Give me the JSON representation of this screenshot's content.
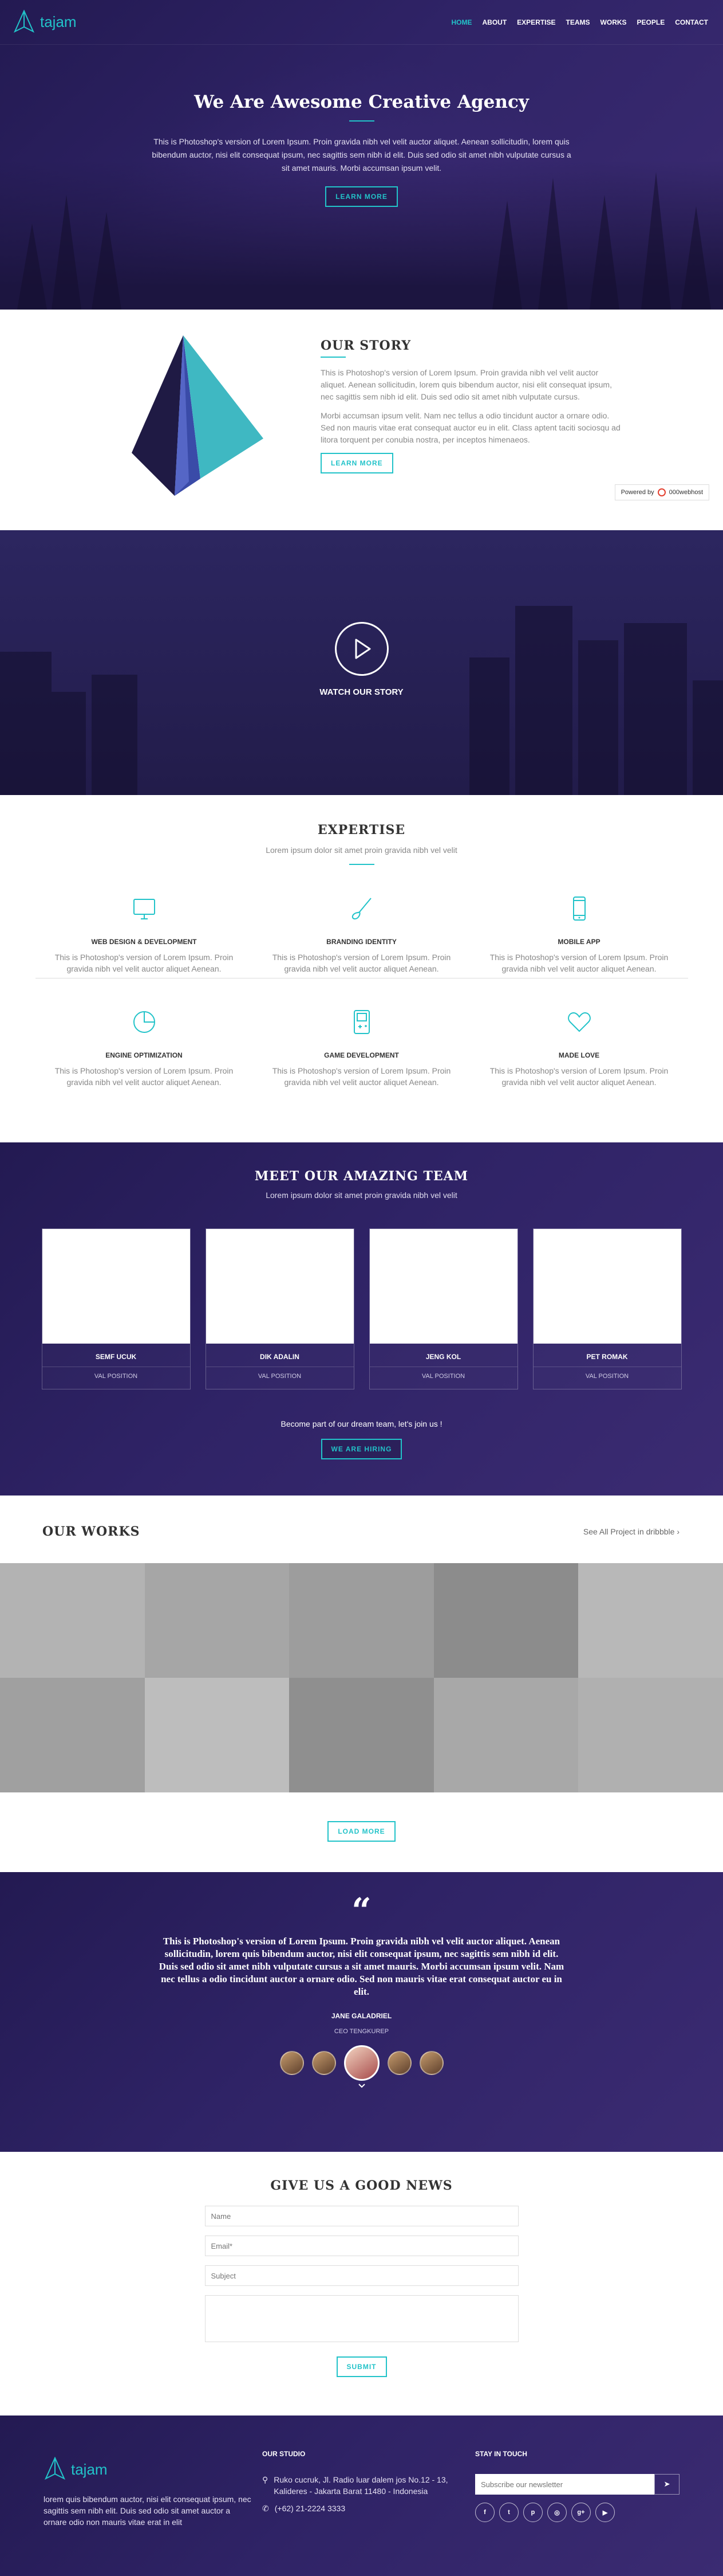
{
  "brand": {
    "name": "tajam",
    "accent": "#22c3c9",
    "dark_purple": "#2a2060"
  },
  "nav": {
    "items": [
      {
        "label": "HOME",
        "active": true
      },
      {
        "label": "ABOUT"
      },
      {
        "label": "EXPERTISE"
      },
      {
        "label": "TEAMS"
      },
      {
        "label": "WORKS"
      },
      {
        "label": "PEOPLE"
      },
      {
        "label": "CONTACT"
      }
    ]
  },
  "hero": {
    "title": "We Are Awesome Creative Agency",
    "body": "This is Photoshop's version of Lorem Ipsum. Proin gravida nibh vel velit auctor aliquet. Aenean sollicitudin, lorem quis bibendum auctor, nisi elit consequat ipsum, nec sagittis sem nibh id elit. Duis sed odio sit amet nibh vulputate cursus a sit amet mauris. Morbi accumsan ipsum velit.",
    "cta": "LEARN MORE"
  },
  "story": {
    "title": "OUR STORY",
    "p1": "This is Photoshop's version of Lorem Ipsum. Proin gravida nibh vel velit auctor aliquet. Aenean sollicitudin, lorem quis bibendum auctor, nisi elit consequat ipsum, nec sagittis sem nibh id elit. Duis sed odio sit amet nibh vulputate cursus.",
    "p2": "Morbi accumsan ipsum velit. Nam nec tellus a odio tincidunt auctor a ornare odio. Sed non mauris vitae erat consequat auctor eu in elit. Class aptent taciti sociosqu ad litora torquent per conubia nostra, per inceptos himenaeos.",
    "cta": "LEARN MORE",
    "powered_prefix": "Powered by",
    "powered_host": "000webhost"
  },
  "video": {
    "label": "WATCH OUR STORY"
  },
  "expertise": {
    "title": "EXPERTISE",
    "subtitle": "Lorem ipsum dolor sit amet proin gravida nibh vel velit",
    "items": [
      {
        "icon": "monitor-icon",
        "title": "WEB DESIGN & DEVELOPMENT",
        "text": "This is Photoshop's version of Lorem Ipsum. Proin gravida nibh vel velit auctor aliquet Aenean."
      },
      {
        "icon": "brush-icon",
        "title": "BRANDING IDENTITY",
        "text": "This is Photoshop's version of Lorem Ipsum. Proin gravida nibh vel velit auctor aliquet Aenean."
      },
      {
        "icon": "mobile-icon",
        "title": "MOBILE APP",
        "text": "This is Photoshop's version of Lorem Ipsum. Proin gravida nibh vel velit auctor aliquet Aenean."
      },
      {
        "icon": "pie-chart-icon",
        "title": "ENGINE OPTIMIZATION",
        "text": "This is Photoshop's version of Lorem Ipsum. Proin gravida nibh vel velit auctor aliquet Aenean."
      },
      {
        "icon": "gameboy-icon",
        "title": "GAME DEVELOPMENT",
        "text": "This is Photoshop's version of Lorem Ipsum. Proin gravida nibh vel velit auctor aliquet Aenean."
      },
      {
        "icon": "heart-icon",
        "title": "MADE LOVE",
        "text": "This is Photoshop's version of Lorem Ipsum. Proin gravida nibh vel velit auctor aliquet Aenean."
      }
    ]
  },
  "team": {
    "title": "MEET OUR AMAZING TEAM",
    "subtitle": "Lorem ipsum dolor sit amet proin gravida nibh vel velit",
    "members": [
      {
        "name": "SEMF UCUK",
        "position": "VAL POSITION"
      },
      {
        "name": "DIK ADALIN",
        "position": "VAL POSITION"
      },
      {
        "name": "JENG KOL",
        "position": "VAL POSITION"
      },
      {
        "name": "PET ROMAK",
        "position": "VAL POSITION"
      }
    ],
    "join_text": "Become part of our dream team, let's join us !",
    "cta": "WE ARE HIRING"
  },
  "works": {
    "title": "OUR WORKS",
    "see_all": "See All Project in dribbble",
    "tiles": [
      "#b3b3b3",
      "#a6a6a6",
      "#9d9d9d",
      "#8c8c8c",
      "#b8b8b8",
      "#a0a0a0",
      "#bdbdbd",
      "#8f8f8f",
      "#a8a8a8",
      "#b0b0b0"
    ],
    "cta": "LOAD MORE"
  },
  "testimonial": {
    "quote_mark": "“",
    "quote": "This is Photoshop's version of Lorem Ipsum. Proin gravida nibh vel velit auctor aliquet. Aenean sollicitudin, lorem quis bibendum auctor, nisi elit consequat ipsum, nec sagittis sem nibh id elit. Duis sed odio sit amet nibh vulputate cursus a sit amet mauris. Morbi accumsan ipsum velit. Nam nec tellus a odio tincidunt auctor a ornare odio. Sed non mauris vitae erat consequat auctor eu in elit.",
    "name": "JANE GALADRIEL",
    "role": "CEO TENGKUREP"
  },
  "contact": {
    "title": "GIVE US A GOOD NEWS",
    "name_placeholder": "Name",
    "email_placeholder": "Email*",
    "subject_placeholder": "Subject",
    "submit": "SUBMIT"
  },
  "footer": {
    "about": "lorem quis bibendum auctor, nisi elit consequat ipsum, nec sagittis sem nibh elit. Duis sed odio sit amet auctor a ornare odio non mauris vitae erat in elit",
    "studio_title": "OUR STUDIO",
    "address": "Ruko cucruk, Jl. Radio luar dalem jos No.12 - 13, Kalideres - Jakarta Barat 11480 - Indonesia",
    "phone": "(+62) 21-2224 3333",
    "stay_title": "STAY IN TOUCH",
    "newsletter_placeholder": "Subscribe our newsletter",
    "socials": [
      "facebook-icon",
      "twitter-icon",
      "pinterest-icon",
      "instagram-icon",
      "google-plus-icon",
      "youtube-icon"
    ]
  }
}
